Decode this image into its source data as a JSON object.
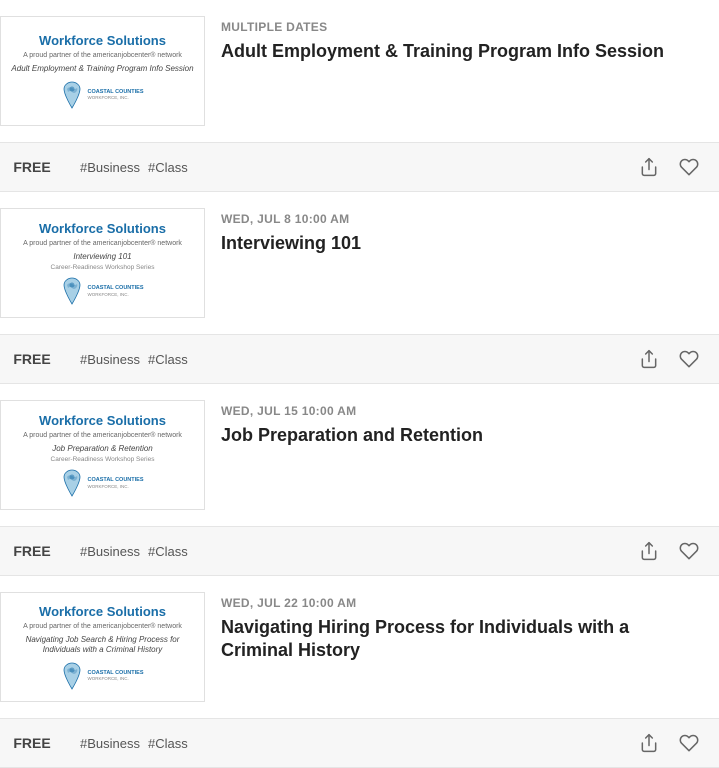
{
  "events": [
    {
      "id": "event-1",
      "date": "MULTIPLE DATES",
      "title": "Adult Employment & Training Program Info Session",
      "price": "FREE",
      "tags": [
        "#Business",
        "#Class"
      ],
      "thumbnail": {
        "title": "Workforce Solutions",
        "subtitle": "A proud partner of the americanjobcenter® network",
        "session": "Adult Employment & Training Program Info Session",
        "workshop": ""
      }
    },
    {
      "id": "event-2",
      "date": "WED, JUL 8 10:00 AM",
      "title": "Interviewing 101",
      "price": "FREE",
      "tags": [
        "#Business",
        "#Class"
      ],
      "thumbnail": {
        "title": "Workforce Solutions",
        "subtitle": "A proud partner of the americanjobcenter® network",
        "session": "Interviewing 101",
        "workshop": "Career-Readiness Workshop Series"
      }
    },
    {
      "id": "event-3",
      "date": "WED, JUL 15 10:00 AM",
      "title": "Job Preparation and Retention",
      "price": "FREE",
      "tags": [
        "#Business",
        "#Class"
      ],
      "thumbnail": {
        "title": "Workforce Solutions",
        "subtitle": "A proud partner of the americanjobcenter® network",
        "session": "Job Preparation & Retention",
        "workshop": "Career-Readiness Workshop Series"
      }
    },
    {
      "id": "event-4",
      "date": "WED, JUL 22 10:00 AM",
      "title": "Navigating Hiring Process for Individuals with a Criminal History",
      "price": "FREE",
      "tags": [
        "#Business",
        "#Class"
      ],
      "thumbnail": {
        "title": "Workforce Solutions",
        "subtitle": "A proud partner of the americanjobcenter® network",
        "session": "Navigating Job Search & Hiring Process for Individuals with a Criminal History",
        "workshop": ""
      }
    }
  ],
  "org": {
    "name": "COASTAL COUNTIES",
    "sub": "WORKFORCE, INC."
  }
}
